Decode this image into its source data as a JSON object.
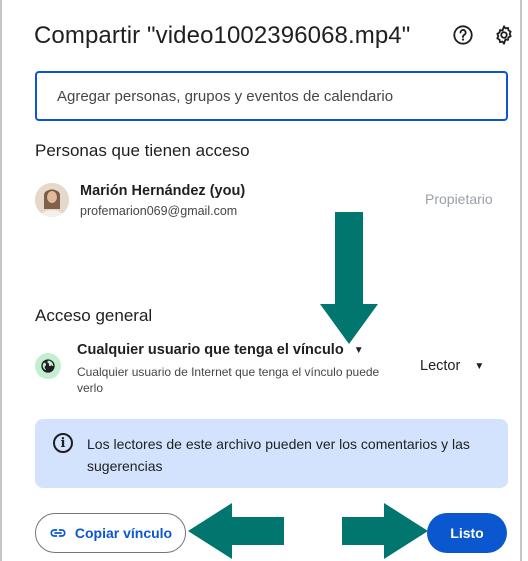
{
  "dialog": {
    "title": "Compartir \"video1002396068.mp4\"",
    "help_icon": "help-circle-icon",
    "settings_icon": "gear-icon"
  },
  "add_people": {
    "placeholder": "Agregar personas, grupos y eventos de calendario"
  },
  "people_section": {
    "title": "Personas que tienen acceso",
    "users": [
      {
        "name": "Marión Hernández (you)",
        "email": "profemarion069@gmail.com",
        "role": "Propietario"
      }
    ]
  },
  "general_access": {
    "title": "Acceso general",
    "option": "Cualquier usuario que tenga el vínculo",
    "description": "Cualquier usuario de Internet que tenga el vínculo puede verlo",
    "role": "Lector",
    "icon": "globe-icon"
  },
  "info": {
    "text": "Los lectores de este archivo pueden ver los comentarios y las sugerencias",
    "icon": "info-icon"
  },
  "footer": {
    "copy_link_label": "Copiar vínculo",
    "done_label": "Listo"
  },
  "colors": {
    "accent": "#0b57d0",
    "info_bg": "#d3e3fd",
    "annotation_arrow": "#00766f"
  }
}
